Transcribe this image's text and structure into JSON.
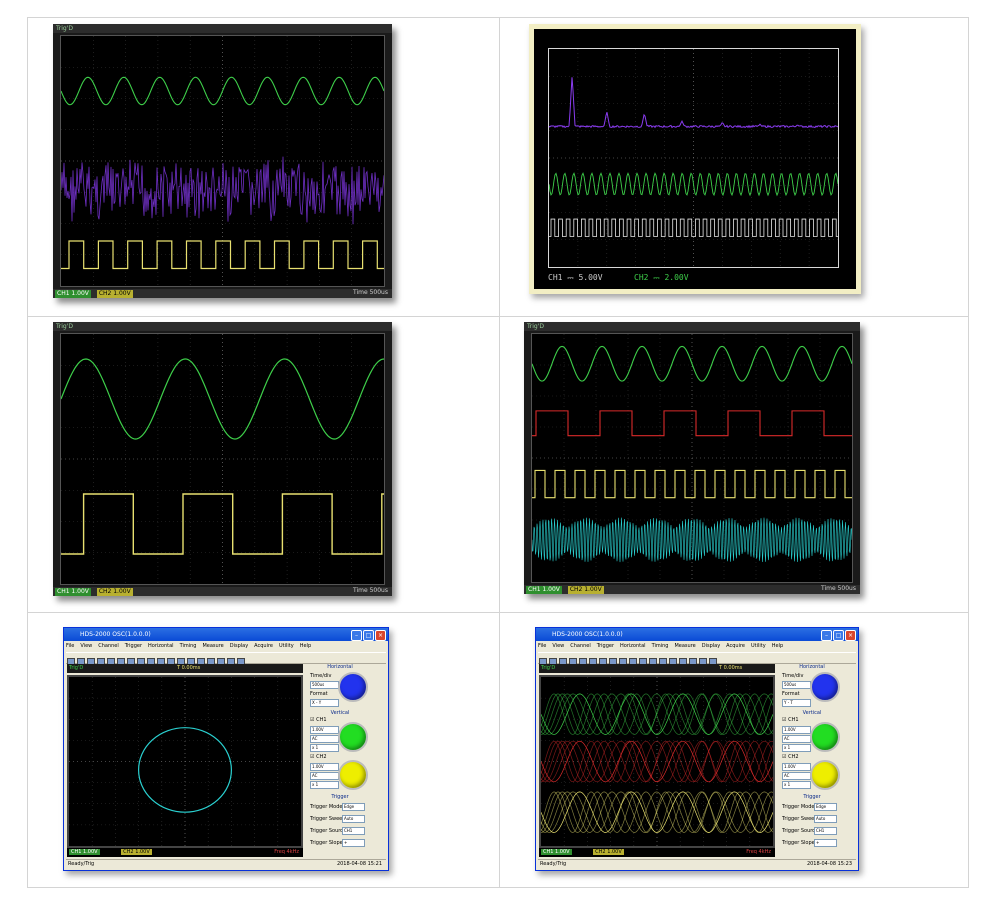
{
  "panel1": {
    "top_bar_left": "Trig'D",
    "footer_ch1": "CH1  1.00V",
    "footer_ch2": "CH2  1.00V",
    "footer_time": "Time  500us"
  },
  "panel2": {
    "ch1_readout": "CH1 ⎓ 5.00V",
    "ch2_readout": "CH2 ⎓ 2.00V"
  },
  "panel3": {
    "top_bar_left": "Trig'D",
    "footer_ch1": "CH1  1.00V",
    "footer_ch2": "CH2  1.00V",
    "footer_time": "Time  500us"
  },
  "panel4": {
    "top_bar_left": "Trig'D",
    "footer_ch1": "CH1  1.00V",
    "footer_ch2": "CH2  1.00V",
    "footer_time": "Time  500us"
  },
  "win5": {
    "title": "HDS-2000 OSC(1.0.0.0)",
    "menu": [
      "File",
      "View",
      "Channel",
      "Trigger",
      "Horizontal",
      "Timing",
      "Measure",
      "Display",
      "Acquire",
      "Utility",
      "Help"
    ],
    "ch_header_left": "Trig'D",
    "ch_header_right": "T  0.00ms",
    "foot_ch1": "CH1  1.00V",
    "foot_ch2": "CH2  1.00V",
    "foot_freq": "Freq  4kHz",
    "status_left": "Ready/Trig",
    "status_right": "2018-04-08  15:21",
    "side": {
      "horizontal": "Horizontal",
      "time_div_label": "Time/div",
      "time_div_value": "500us",
      "format_label": "Format",
      "format_value": "X - Y",
      "vertical": "Vertical",
      "ch1_check": "CH1",
      "ch2_check": "CH2",
      "ch1_volt": "1.00V",
      "ch1_coupling": "AC",
      "ch1_probe": "x 1",
      "ch2_volt": "1.00V",
      "ch2_coupling": "AC",
      "ch2_probe": "x 1",
      "trigger": "Trigger",
      "trig_mode_label": "Trigger Mode",
      "trig_mode_value": "Edge",
      "trig_sweep_label": "Trigger Sweep",
      "trig_sweep_value": "Auto",
      "trig_source_label": "Trigger Source",
      "trig_source_value": "CH1",
      "trig_slope_label": "Trigger Slope",
      "trig_slope_value": "+"
    },
    "colors": {
      "knob1": "#2233ee",
      "knob2": "#22dd22",
      "knob3": "#eeee00"
    }
  },
  "win6": {
    "title": "HDS-2000 OSC(1.0.0.0)",
    "menu": [
      "File",
      "View",
      "Channel",
      "Trigger",
      "Horizontal",
      "Timing",
      "Measure",
      "Display",
      "Acquire",
      "Utility",
      "Help"
    ],
    "ch_header_left": "Trig'D",
    "ch_header_right": "T  0.00ms",
    "foot_ch1": "CH1  1.00V",
    "foot_ch2": "CH2  1.00V",
    "foot_freq": "Freq  4kHz",
    "status_left": "Ready/Trig",
    "status_right": "2018-04-08  15:23",
    "side": {
      "horizontal": "Horizontal",
      "time_div_label": "Time/div",
      "time_div_value": "500us",
      "format_label": "Format",
      "format_value": "Y - T",
      "vertical": "Vertical",
      "ch1_check": "CH1",
      "ch2_check": "CH2",
      "ch1_volt": "1.00V",
      "ch1_coupling": "AC",
      "ch1_probe": "x 1",
      "ch2_volt": "1.00V",
      "ch2_coupling": "AC",
      "ch2_probe": "x 1",
      "trigger": "Trigger",
      "trig_mode_label": "Trigger Mode",
      "trig_mode_value": "Edge",
      "trig_sweep_label": "Trigger Sweep",
      "trig_sweep_value": "Auto",
      "trig_source_label": "Trigger Source",
      "trig_source_value": "CH1",
      "trig_slope_label": "Trigger Slope",
      "trig_slope_value": "+"
    },
    "colors": {
      "knob1": "#2233ee",
      "knob2": "#22dd22",
      "knob3": "#eeee00"
    }
  },
  "colors": {
    "sine": "#3ecf4a",
    "square": "#e8e070",
    "noise": "#7a34d8",
    "red": "#d82a2a",
    "cyan": "#2ad0d0",
    "fft": "#8a3cf0"
  }
}
